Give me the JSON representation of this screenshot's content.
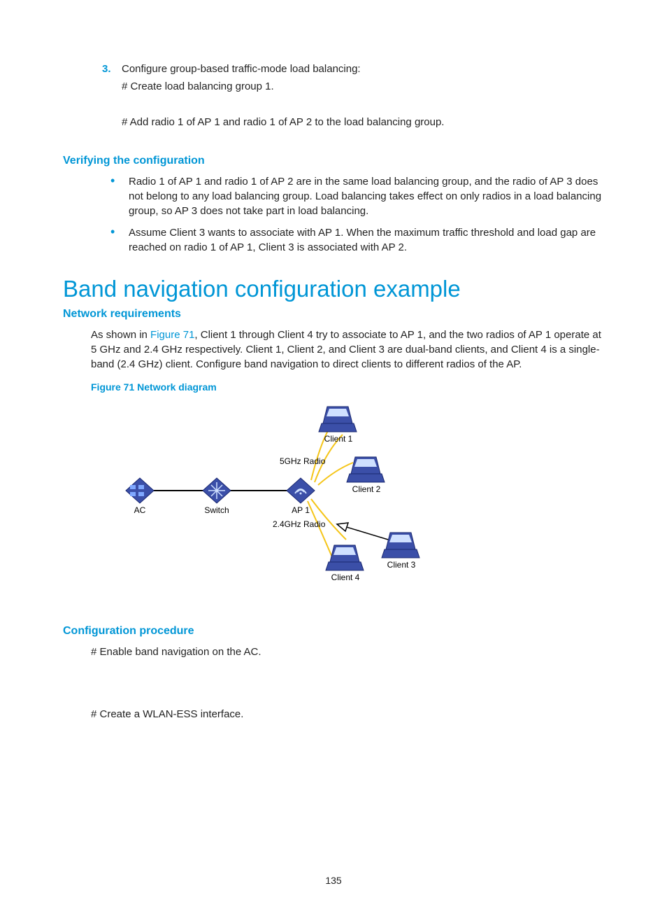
{
  "step3": {
    "num": "3.",
    "text": "Configure group-based traffic-mode load balancing:",
    "sub1": "# Create load balancing group 1.",
    "sub2": "# Add radio 1 of AP 1 and radio 1 of AP 2 to the load balancing group."
  },
  "verify": {
    "heading": "Verifying the configuration",
    "b1": "Radio 1 of AP 1 and radio 1 of AP 2 are in the same load balancing group, and the radio of AP 3 does not belong to any load balancing group. Load balancing takes effect on only radios in a load balancing group, so AP 3 does not take part in load balancing.",
    "b2": "Assume Client 3 wants to associate with AP 1. When the maximum traffic threshold and load gap are reached on radio 1 of AP 1, Client 3 is associated with AP 2."
  },
  "main_heading": "Band navigation configuration example",
  "netreq": {
    "heading": "Network requirements",
    "pre": "As shown in ",
    "figref": "Figure 71",
    "post": ", Client 1 through Client 4 try to associate to AP 1, and the two radios of AP 1 operate at 5 GHz and 2.4 GHz respectively. Client 1, Client 2, and Client 3 are dual-band clients, and Client 4 is a single-band (2.4 GHz) client. Configure band navigation to direct clients to different radios of the AP."
  },
  "figure": {
    "caption": "Figure 71 Network diagram",
    "labels": {
      "ac": "AC",
      "switch": "Switch",
      "ap1": "AP 1",
      "r5": "5GHz Radio",
      "r24": "2.4GHz Radio",
      "c1": "Client 1",
      "c2": "Client 2",
      "c3": "Client 3",
      "c4": "Client 4"
    }
  },
  "proc": {
    "heading": "Configuration procedure",
    "s1": "# Enable band navigation on the AC.",
    "s2": "# Create a WLAN-ESS interface."
  },
  "page_number": "135"
}
